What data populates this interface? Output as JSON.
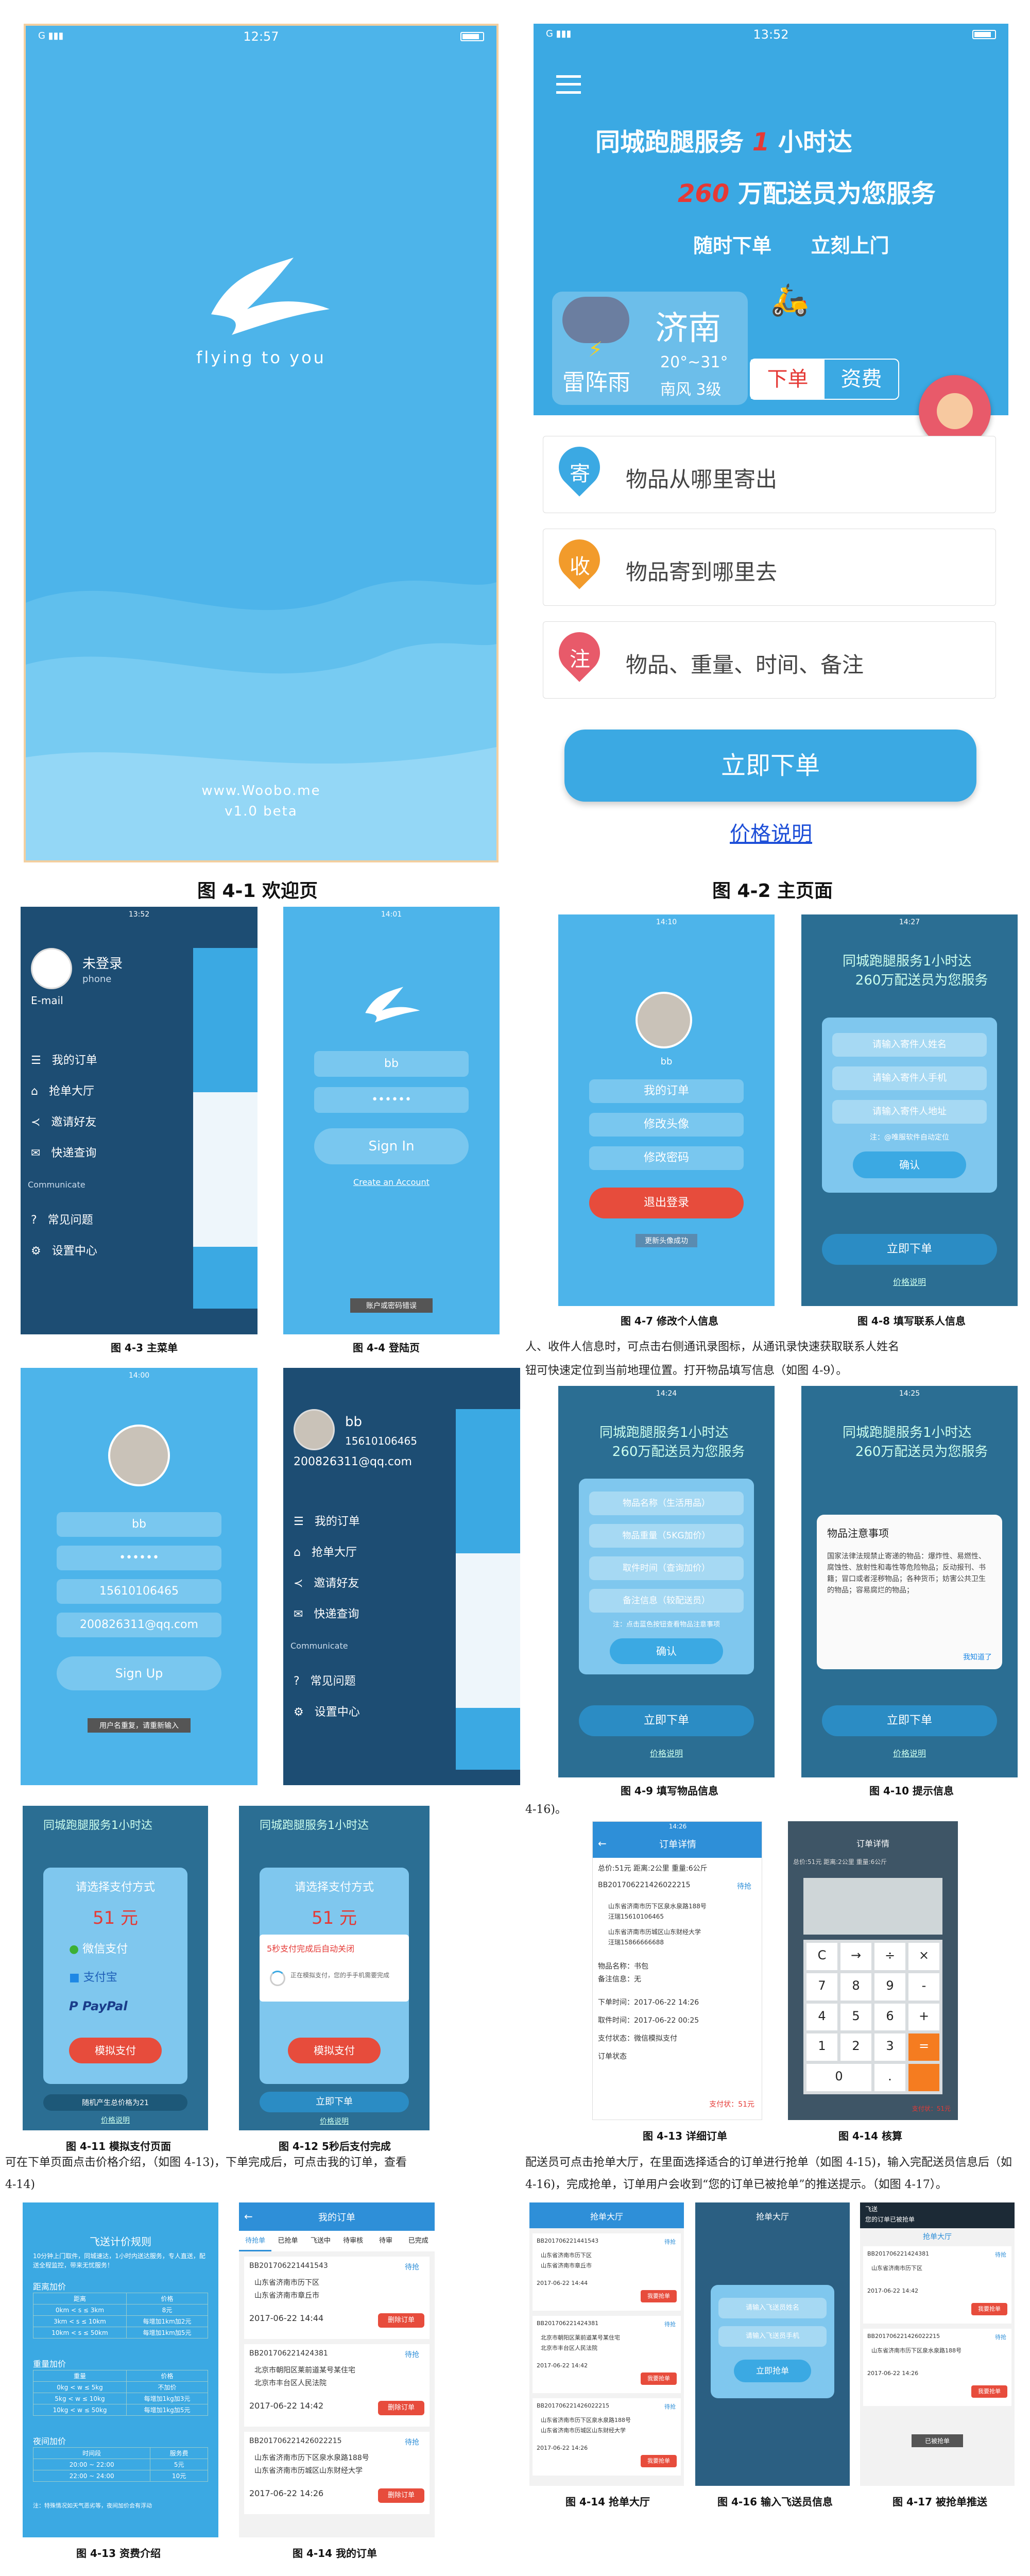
{
  "captions": {
    "f41": "图 4-1  欢迎页",
    "f42": "图 4-2  主页面",
    "f43": "图 4-3  主菜单",
    "f44": "图 4-4  登陆页",
    "f47": "图 4-7  修改个人信息",
    "f48": "图 4-8  填写联系人信息",
    "f49": "图 4-9  填写物品信息",
    "f410": "图 4-10  提示信息",
    "f411": "图 4-11  模拟支付页面",
    "f412": "图 4-12  5秒后支付完成",
    "f413a": "图 4-13  详细订单",
    "f414a": "图 4-14  核算",
    "f413b": "图 4-13  资费介绍",
    "f414b": "图 4-14  我的订单",
    "f414c": "图 4-14  抢单大厅",
    "f416": "图 4-16  输入飞送员信息",
    "f417": "图 4-17  被抢单推送"
  },
  "paragraphs": {
    "p1": "人、收件人信息时，可点击右侧通讯录图标，从通讯录快速获取联系人姓名",
    "p2": "钮可快速定位到当前地理位置。打开物品填写信息（如图 4-9）。",
    "p3": "4-16)。",
    "p4": "可在下单页面点击价格介绍，（如图 4-13)，下单完成后，可点击我的订单，查看",
    "p5": "4-14)",
    "p6": "配送员可点击抢单大厅，在里面选择适合的订单进行抢单（如图 4-15)，输入完配送员信息后（如",
    "p7": "4-16)，完成抢单，订单用户会收到“您的订单已被抢单”的推送提示。（如图 4-17）。"
  },
  "welcome": {
    "time": "12:57",
    "logo_text": "flying to you",
    "site": "www.Woobo.me",
    "version": "v1.0 beta"
  },
  "main": {
    "time": "13:52",
    "headline1": "同城跑腿服务",
    "headline1b": "1",
    "headline1c": "小时达",
    "headline2a": "260",
    "headline2b": "万配送员为您服务",
    "slogan1": "随时下单",
    "slogan2": "立刻上门",
    "city": "济南",
    "weather": "雷阵雨",
    "temp": "20°~31°",
    "wind": "南风 3级",
    "tab_order": "下单",
    "tab_fee": "资费",
    "row1_badge": "寄",
    "row1_text": "物品从哪里寄出",
    "row2_badge": "收",
    "row2_text": "物品寄到哪里去",
    "row3_badge": "注",
    "row3_text": "物品、重量、时间、备注",
    "order_button": "立即下单",
    "price_link": "价格说明"
  },
  "menu": {
    "time": "13:52",
    "user": "未登录",
    "phone": "phone",
    "email": "E-mail",
    "items": [
      "我的订单",
      "抢单大厅",
      "邀请好友",
      "快递查询"
    ],
    "section": "Communicate",
    "items2": [
      "常见问题",
      "设置中心"
    ]
  },
  "login": {
    "time": "14:01",
    "user": "bb",
    "pwd": "••••••",
    "signin": "Sign In",
    "create": "Create an Account",
    "error": "账户或密码错误"
  },
  "profile": {
    "time": "14:10",
    "name": "bb",
    "btn1": "我的订单",
    "btn2": "修改头像",
    "btn3": "修改密码",
    "logout": "退出登录",
    "toast": "更新头像成功"
  },
  "contact": {
    "time": "14:27",
    "f1": "请输入寄件人姓名",
    "f2": "请输入寄件人手机",
    "f3": "请输入寄件人地址",
    "note": "注：@唯服软件自动定位",
    "confirm": "确认",
    "bottom": "立即下单",
    "link": "价格说明"
  },
  "signup": {
    "time": "14:00",
    "user": "bb",
    "pwd": "••••••",
    "phone": "15610106465",
    "email": "200826311@qq.com",
    "btn": "Sign Up",
    "error": "用户名重复，请重新输入"
  },
  "menu2": {
    "user": "bb",
    "phone": "15610106465",
    "email": "200826311@qq.com",
    "items": [
      "我的订单",
      "抢单大厅",
      "邀请好友",
      "快递查询"
    ],
    "section": "Communicate",
    "items2": [
      "常见问题",
      "设置中心"
    ]
  },
  "item": {
    "time": "14:24",
    "f1": "物品名称（生活用品）",
    "f2": "物品重量（5KG加价）",
    "f3": "取件时间（查询加价）",
    "f4": "备注信息（较配送员）",
    "note": "注：点击蓝色按钮查看物品注意事项",
    "confirm": "确认",
    "bottom": "立即下单",
    "link": "价格说明"
  },
  "notice": {
    "time": "14:25",
    "title": "物品注意事项",
    "body": "国家法律法规禁止寄递的物品：爆炸性、易燃性、腐蚀性、放射性和毒性等危险物品；反动报刊、书籍；冒口或者淫秽物品；各种货币；妨害公共卫生的物品；容易腐烂的物品；",
    "ok": "我知道了",
    "bottom": "立即下单",
    "link": "价格说明"
  },
  "pay": {
    "title": "请选择支付方式",
    "amount": "51 元",
    "wechat": "微信支付",
    "alipay": "支付宝",
    "paypal": "PayPal",
    "btn": "模拟支付",
    "bottom": "随机产生总价格为21",
    "link": "价格说明"
  },
  "pay2": {
    "title": "请选择支付方式",
    "amount": "51 元",
    "done": "5秒支付完成后自动关闭",
    "wait": "正在模拟支付，您的手手机需要完成",
    "btn": "模拟支付",
    "bottom": "立即下单",
    "link": "价格说明"
  },
  "detail": {
    "time": "14:26",
    "title": "订单详情",
    "summary": "总价:51元  距离:2公里  重量:6公斤",
    "order_no": "BB201706221426022215",
    "status": "待抢",
    "from": "山东省济南市历下区泉水泉路188号",
    "from_phone": "汪瑞15610106465",
    "to": "山东省济南市历城区山东财经大学",
    "to_phone": "汪瑞15866666688",
    "name": "物品名称：书包",
    "remark": "备注信息：无",
    "t1": "下单时间：2017-06-22 14:26",
    "t2": "取件时间：2017-06-22 00:25",
    "pay_state": "支付状态：微信模拟支付",
    "state": "订单状态",
    "paid": "支付状：51元"
  },
  "calc": {
    "title": "订单详情",
    "summary": "总价:51元  距离:2公里  重量:6公斤",
    "keys": [
      "C",
      "→",
      "÷",
      "×",
      "7",
      "8",
      "9",
      "-",
      "4",
      "5",
      "6",
      "+",
      "1",
      "2",
      "3",
      "=",
      "0",
      ".",
      "",
      ""
    ],
    "paid": "支付状：51元"
  },
  "fee": {
    "title": "飞送计价规则",
    "intro": "10分钟上门取件，同城速达，1小时内送达服务，专人直送，配送全程监控，带来无忧服务！",
    "s1": "距离加价",
    "s1_rows": [
      [
        "距离",
        "价格"
      ],
      [
        "0km < s ≤ 3km",
        "8元"
      ],
      [
        "3km < s ≤ 10km",
        "每增加1km加2元"
      ],
      [
        "10km < s ≤ 50km",
        "每增加1km加5元"
      ]
    ],
    "s2": "重量加价",
    "s2_rows": [
      [
        "重量",
        "价格"
      ],
      [
        "0kg < w ≤ 5kg",
        "不加价"
      ],
      [
        "5kg < w ≤ 10kg",
        "每增加1kg加3元"
      ],
      [
        "10kg < w ≤ 50kg",
        "每增加1kg加5元"
      ]
    ],
    "s3": "夜间加价",
    "s3_rows": [
      [
        "时间段",
        "服务费"
      ],
      [
        "20:00 ~ 22:00",
        "5元"
      ],
      [
        "22:00 ~ 24:00",
        "10元"
      ]
    ],
    "note": "注：特殊情况如天气恶劣等，夜间加价会有浮动"
  },
  "myorders": {
    "title": "我的订单",
    "tabs": [
      "待抢单",
      "已抢单",
      "飞送中",
      "待审核",
      "待审",
      "已完成"
    ],
    "orders": [
      {
        "no": "BB201706221441543",
        "status": "待抢",
        "from": "山东省济南市历下区",
        "to": "山东省济南市章丘市",
        "time": "2017-06-22 14:44",
        "btn": "删除订单"
      },
      {
        "no": "BB201706221424381",
        "status": "待抢",
        "from": "北京市朝阳区莱前道某号某住宅",
        "to": "北京市丰台区人民法院",
        "time": "2017-06-22 14:42",
        "btn": "删除订单"
      },
      {
        "no": "BB201706221426022215",
        "status": "待抢",
        "from": "山东省济南市历下区泉水泉路188号",
        "to": "山东省济南市历城区山东财经大学",
        "time": "2017-06-22 14:26",
        "btn": "删除订单"
      }
    ]
  },
  "hall": {
    "title": "抢单大厅",
    "orders": [
      {
        "no": "BB201706221441543",
        "status": "待抢",
        "from": "山东省济南市历下区",
        "to": "山东省济南市章丘市",
        "time": "2017-06-22 14:44",
        "btn": "我要抢单"
      },
      {
        "no": "BB201706221424381",
        "status": "待抢",
        "from": "北京市朝阳区莱前道某号某住宅",
        "to": "北京市丰台区人民法院",
        "time": "2017-06-22 14:42",
        "btn": "我要抢单"
      },
      {
        "no": "BB201706221426022215",
        "status": "待抢",
        "from": "山东省济南市历下区泉水泉路188号",
        "to": "山东省济南市历城区山东财经大学",
        "time": "2017-06-22 14:26",
        "btn": "我要抢单"
      }
    ]
  },
  "courier": {
    "title": "抢单大厅",
    "f1": "请输入飞送员姓名",
    "f2": "请输入飞送员手机",
    "btn": "立即抢单"
  },
  "push": {
    "title": "飞送",
    "msg": "您的订单已被抢单",
    "header": "抢单大厅",
    "orders": [
      {
        "no": "BB201706221424381",
        "status": "待抢",
        "from": "山东省济南市历下区",
        "time": "2017-06-22 14:42",
        "btn": "我要抢单"
      },
      {
        "no": "BB201706221426022215",
        "status": "待抢",
        "from": "山东省济南市历下区泉水泉路188号",
        "time": "2017-06-22 14:26",
        "btn": "我要抢单"
      }
    ],
    "toast": "已被抢单"
  }
}
